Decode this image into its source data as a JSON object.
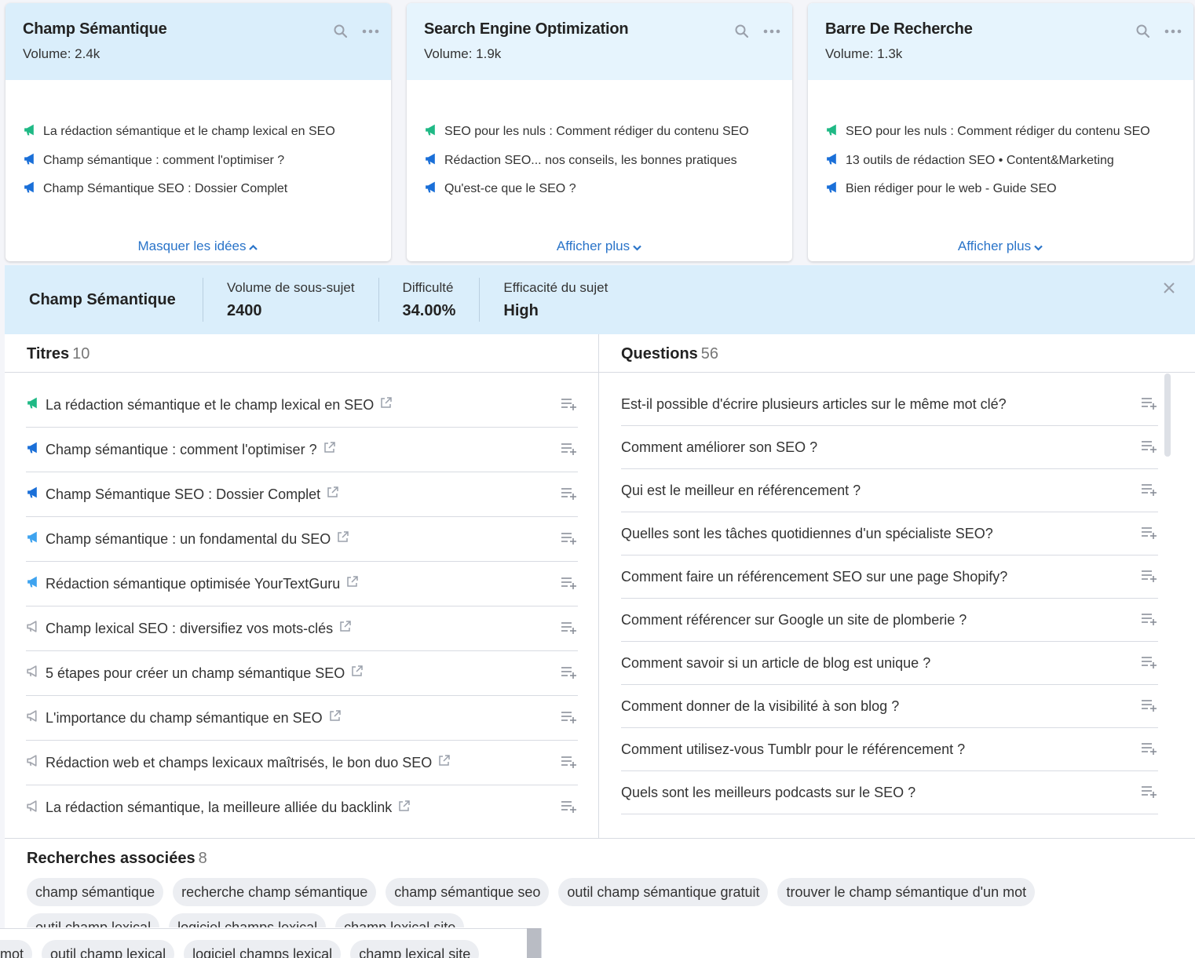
{
  "cards": [
    {
      "title": "Champ Sémantique",
      "volume": "Volume: 2.4k",
      "items": [
        {
          "text": "La rédaction sémantique et le champ lexical en SEO",
          "icon": "megaphone-green-icon"
        },
        {
          "text": "Champ sémantique : comment l'optimiser ?",
          "icon": "megaphone-blue-icon"
        },
        {
          "text": "Champ Sémantique SEO : Dossier Complet",
          "icon": "megaphone-blue-icon"
        }
      ],
      "footer": "Masquer les idées",
      "footer_icon": "chevron-up-icon"
    },
    {
      "title": "Search Engine Optimization",
      "volume": "Volume: 1.9k",
      "items": [
        {
          "text": "SEO pour les nuls : Comment rédiger du contenu SEO",
          "icon": "megaphone-green-icon"
        },
        {
          "text": "Rédaction SEO... nos conseils, les bonnes pratiques",
          "icon": "megaphone-blue-icon"
        },
        {
          "text": "Qu'est-ce que le SEO ?",
          "icon": "megaphone-blue-icon"
        }
      ],
      "footer": "Afficher plus",
      "footer_icon": "chevron-down-icon"
    },
    {
      "title": "Barre De Recherche",
      "volume": "Volume: 1.3k",
      "items": [
        {
          "text": "SEO pour les nuls : Comment rédiger du contenu SEO",
          "icon": "megaphone-green-icon"
        },
        {
          "text": "13 outils de rédaction SEO • Content&Marketing",
          "icon": "megaphone-blue-icon"
        },
        {
          "text": "Bien rédiger pour le web - Guide SEO",
          "icon": "megaphone-blue-icon"
        }
      ],
      "footer": "Afficher plus",
      "footer_icon": "chevron-down-icon"
    }
  ],
  "detail": {
    "title": "Champ Sémantique",
    "metrics": [
      {
        "label": "Volume de sous-sujet",
        "value": "2400"
      },
      {
        "label": "Difficulté",
        "value": "34.00%"
      },
      {
        "label": "Efficacité du sujet",
        "value": "High"
      }
    ],
    "titles_label": "Titres",
    "titles_count": "10",
    "titles": [
      {
        "text": "La rédaction sémantique et le champ lexical en SEO",
        "level": "green"
      },
      {
        "text": "Champ sémantique : comment l'optimiser ?",
        "level": "blue"
      },
      {
        "text": "Champ Sémantique SEO : Dossier Complet",
        "level": "blue"
      },
      {
        "text": "Champ sémantique : un fondamental du SEO",
        "level": "lightblue"
      },
      {
        "text": "Rédaction sémantique optimisée YourTextGuru",
        "level": "lightblue"
      },
      {
        "text": "Champ lexical SEO : diversifiez vos mots-clés",
        "level": "grey"
      },
      {
        "text": "5 étapes pour créer un champ sémantique SEO",
        "level": "grey"
      },
      {
        "text": "L'importance du champ sémantique en SEO",
        "level": "grey"
      },
      {
        "text": "Rédaction web et champs lexicaux maîtrisés, le bon duo SEO",
        "level": "grey"
      },
      {
        "text": "La rédaction sémantique, la meilleure alliée du backlink",
        "level": "grey"
      }
    ],
    "questions_label": "Questions",
    "questions_count": "56",
    "questions": [
      "Est-il possible d'écrire plusieurs articles sur le même mot clé?",
      "Comment améliorer son SEO ?",
      "Qui est le meilleur en référencement ?",
      "Quelles sont les tâches quotidiennes d'un spécialiste SEO?",
      "Comment faire un référencement SEO sur une page Shopify?",
      "Comment référencer sur Google un site de plomberie ?",
      "Comment savoir si un article de blog est unique ?",
      "Comment donner de la visibilité à son blog ?",
      "Comment utilisez-vous Tumblr pour le référencement ?",
      "Quels sont les meilleurs podcasts sur le SEO ?"
    ],
    "related_label": "Recherches associées",
    "related_count": "8",
    "related": [
      "champ sémantique",
      "recherche champ sémantique",
      "champ sémantique seo",
      "outil champ sémantique gratuit",
      "trouver le champ sémantique d'un mot"
    ],
    "related_row2": [
      "outil champ lexical",
      "logiciel champs lexical",
      "champ lexical site"
    ],
    "overlay_row": [
      "un mot",
      "outil champ lexical",
      "logiciel champs lexical",
      "champ lexical site"
    ]
  },
  "colors": {
    "accent_link": "#2a74c9",
    "green": "#1fb985",
    "blue": "#1a6fd8",
    "lightblue": "#3ea3ef",
    "grey": "#a5a8b0",
    "header_bg": "#daeefb"
  }
}
